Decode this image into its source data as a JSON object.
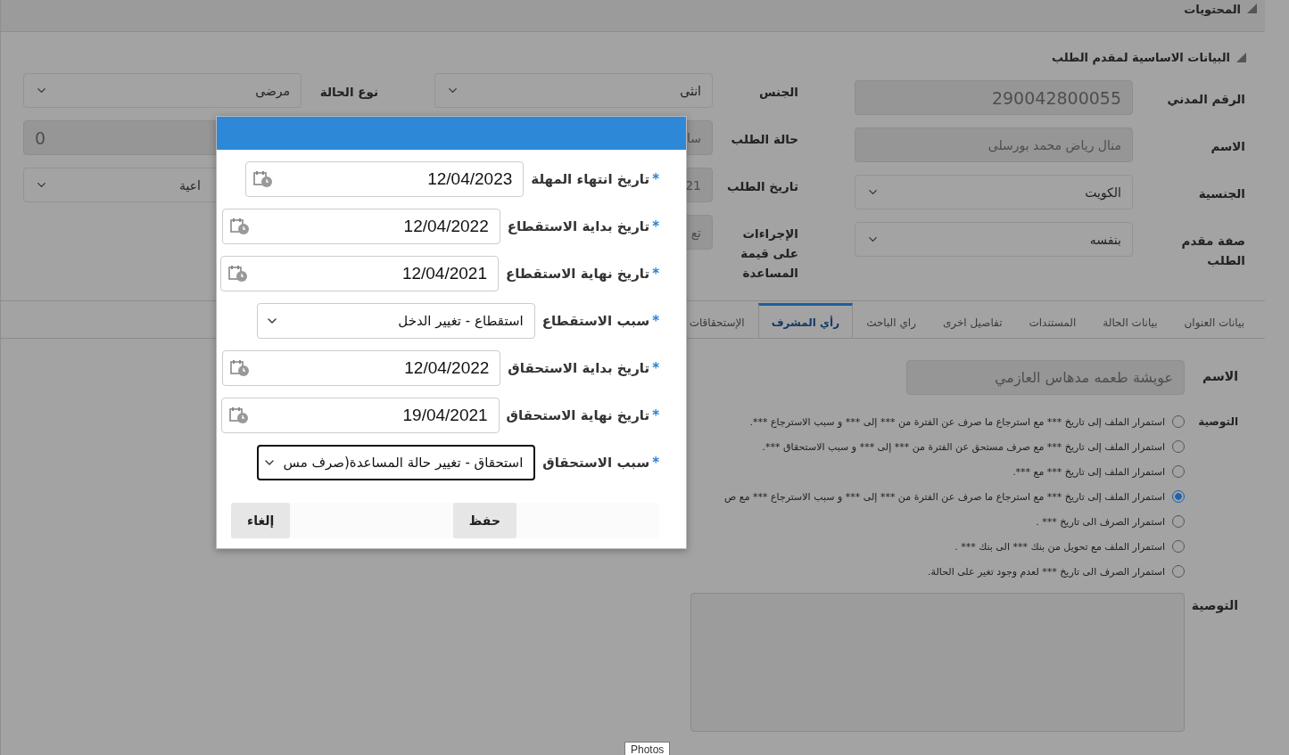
{
  "header": {
    "title": "المحتويات"
  },
  "section": {
    "title": "البيانات الاساسية لمقدم الطلب"
  },
  "form_columns": [
    [
      {
        "label": "الرقم المدني",
        "value": "290042800055",
        "kind": "text",
        "disabled": true
      },
      {
        "label": "الاسم",
        "value": "منال رياض محمد بورسلى",
        "kind": "text",
        "disabled": true
      },
      {
        "label": "الجنسية",
        "value": "الكويت",
        "kind": "select",
        "disabled": false
      },
      {
        "label": "صفة مقدم الطلب",
        "value": "بنفسه",
        "kind": "select",
        "disabled": false
      }
    ],
    [
      {
        "label": "الجنس",
        "value": "انثى",
        "kind": "select",
        "disabled": false
      },
      {
        "label": "حالة الطلب",
        "value": "سا",
        "kind": "text",
        "disabled": true
      },
      {
        "label": "تاريخ الطلب",
        "value": "21",
        "kind": "text",
        "disabled": true
      },
      {
        "label": "الإجراءات على قيمة المساعدة",
        "value": "تع",
        "kind": "text",
        "disabled": true
      }
    ],
    [
      {
        "label": "نوع الحالة",
        "value": "مرضى",
        "kind": "select",
        "disabled": false
      },
      {
        "value": "0",
        "kind": "number",
        "disabled": true
      },
      {
        "value": "اعية",
        "kind": "select",
        "disabled": false
      }
    ]
  ],
  "tabs": [
    {
      "label": "بيانات العنوان",
      "selected": false
    },
    {
      "label": "بيانات الحالة",
      "selected": false
    },
    {
      "label": "المستندات",
      "selected": false
    },
    {
      "label": "تفاصيل اخرى",
      "selected": false
    },
    {
      "label": "راي الباحث",
      "selected": false
    },
    {
      "label": "رأي المشرف",
      "selected": true
    },
    {
      "label": "الإستحقاقات",
      "selected": false
    }
  ],
  "supervisor": {
    "name": {
      "label": "الاسم",
      "value": "عويشة طعمه مدهاس العازمي"
    },
    "recommendation": {
      "label": "التوصية",
      "options": [
        {
          "text": "استمرار الملف إلى تاريخ *** مع استرجاع ما صرف عن الفترة من *** إلى *** و سبب الاسترجاع ***.",
          "selected": false
        },
        {
          "text": "استمرار الملف إلى تاريخ *** مع صرف مستحق عن الفترة من *** إلى *** و سبب الاستحقاق ***.",
          "selected": false
        },
        {
          "text": "استمرار الملف إلى تاريخ *** مع ***.",
          "selected": false
        },
        {
          "text": "استمرار الملف إلى تاريخ *** مع استرجاع ما صرف عن الفترة من *** إلى *** و سبب الاسترجاع *** مع ص",
          "selected": true
        },
        {
          "text": "استمرار الصرف الى تاريخ *** .",
          "selected": false
        },
        {
          "text": "استمرار الملف مع تحويل من بنك *** الى بنك *** .",
          "selected": false
        },
        {
          "text": "استمرار الصرف الى تاريخ *** لعدم وجود تغير على الحالة.",
          "selected": false
        }
      ]
    },
    "notes": {
      "label": "التوصية"
    }
  },
  "tooltip": "Photos",
  "dialog": {
    "fields": [
      {
        "mark": "*",
        "label": "تاريخ انتهاء المهلة",
        "value": "12/04/2023",
        "kind": "date",
        "focused": false
      },
      {
        "mark": "*",
        "label": "تاريخ بداية الاستقطاع",
        "value": "12/04/2022",
        "kind": "date",
        "focused": false
      },
      {
        "mark": "*",
        "label": "تاريخ نهاية الاستقطاع",
        "value": "12/04/2021",
        "kind": "date",
        "focused": false
      },
      {
        "mark": "*",
        "label": "سبب الاستقطاع",
        "value": "استقطاع - تغيير الدخل",
        "kind": "select",
        "focused": false
      },
      {
        "mark": "*",
        "label": "تاريخ بداية الاستحقاق",
        "value": "12/04/2022",
        "kind": "date",
        "focused": false
      },
      {
        "mark": "*",
        "label": "تاريخ نهاية الاستحقاق",
        "value": "19/04/2021",
        "kind": "date",
        "focused": false
      },
      {
        "mark": "*",
        "label": "سبب الاستحقاق",
        "value": "استحقاق - تغيير حالة المساعدة(صرف مس",
        "kind": "select",
        "focused": true
      }
    ],
    "buttons": [
      {
        "label": "حفظ"
      },
      {
        "label": "إلغاء"
      }
    ]
  }
}
